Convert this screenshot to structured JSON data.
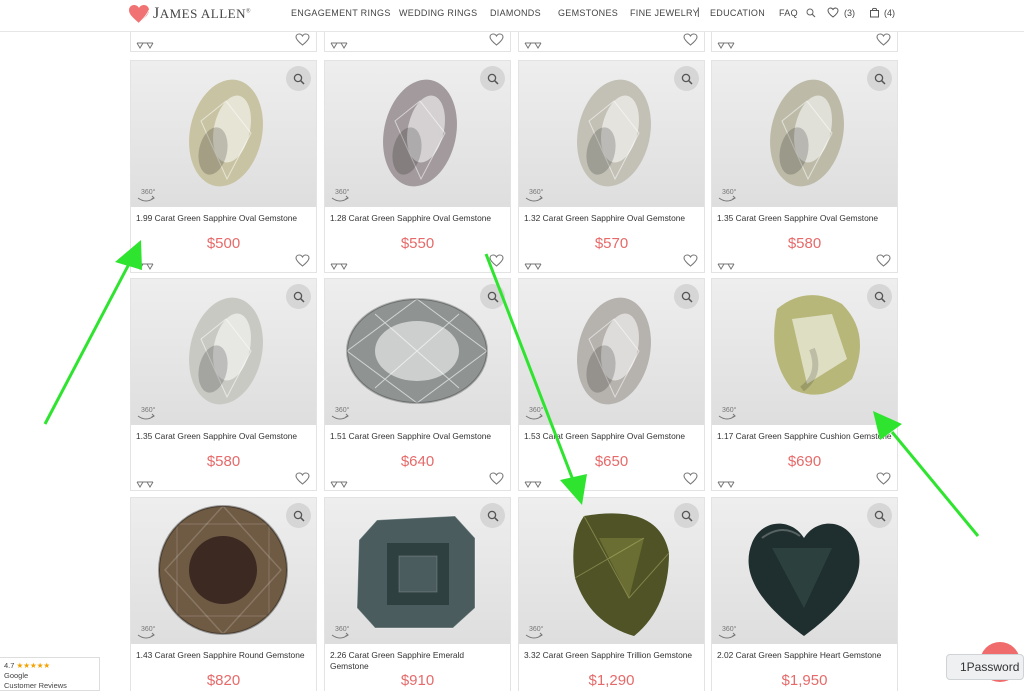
{
  "header": {
    "logo_text_big": "J",
    "logo_text": "AMES ALLEN",
    "logo_mark": "®",
    "nav": [
      "ENGAGEMENT RINGS",
      "WEDDING RINGS",
      "DIAMONDS",
      "GEMSTONES",
      "FINE JEWELRY",
      "EDUCATION",
      "FAQ"
    ],
    "nav_separator": "|",
    "wishlist_count": "(3)",
    "cart_count": "(4)"
  },
  "products": [
    {
      "title": "1.99 Carat Green Sapphire Oval Gemstone",
      "price": "$500",
      "stone": "oval-tilt",
      "color": "#c8c3a2"
    },
    {
      "title": "1.28 Carat Green Sapphire Oval Gemstone",
      "price": "$550",
      "stone": "oval-tilt",
      "color": "#a29a9c"
    },
    {
      "title": "1.32 Carat Green Sapphire Oval Gemstone",
      "price": "$570",
      "stone": "oval-tilt",
      "color": "#c3c1b6"
    },
    {
      "title": "1.35 Carat Green Sapphire Oval Gemstone",
      "price": "$580",
      "stone": "oval-tilt",
      "color": "#bdbba8"
    },
    {
      "title": "1.35 Carat Green Sapphire Oval Gemstone",
      "price": "$580",
      "stone": "oval-tilt",
      "color": "#c9c9c4"
    },
    {
      "title": "1.51 Carat Green Sapphire Oval Gemstone",
      "price": "$640",
      "stone": "oval-face",
      "color": "#8f9493"
    },
    {
      "title": "1.53 Carat Green Sapphire Oval Gemstone",
      "price": "$650",
      "stone": "oval-tilt",
      "color": "#b6b2ae"
    },
    {
      "title": "1.17 Carat Green Sapphire Cushion Gemstone",
      "price": "$690",
      "stone": "cushion",
      "color": "#b7b77a"
    },
    {
      "title": "1.43 Carat Green Sapphire Round Gemstone",
      "price": "$820",
      "stone": "round",
      "color": "#6f5a43"
    },
    {
      "title": "2.26 Carat Green Sapphire Emerald Gemstone",
      "price": "$910",
      "stone": "emerald",
      "color": "#4a5c5e"
    },
    {
      "title": "3.32 Carat Green Sapphire Trillion Gemstone",
      "price": "$1,290",
      "stone": "trillion",
      "color": "#4f5326"
    },
    {
      "title": "2.02 Carat Green Sapphire Heart Gemstone",
      "price": "$1,950",
      "stone": "heart",
      "color": "#1f2e2e"
    }
  ],
  "badge_360": "360°",
  "reviews_badge": {
    "rating": "4.7",
    "stars": "★★★★★",
    "line1": "Google",
    "line2": "Customer Reviews"
  },
  "password_manager": "1Password",
  "colors": {
    "price": "#e66a6a",
    "arrow": "#2fe42f",
    "logo_heart": "#f07272"
  }
}
